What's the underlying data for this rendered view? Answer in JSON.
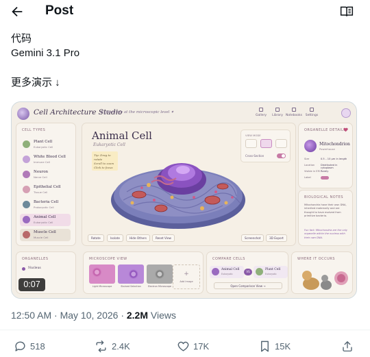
{
  "header": {
    "title": "Post"
  },
  "post": {
    "line1": "代码",
    "line2": "Gemini 3.1 Pro",
    "line3": "更多演示 ↓"
  },
  "video": {
    "timer": "0:07",
    "app": {
      "name": "Cell Architecture Studio",
      "tagline": "Explore life at the microscopic level ✦",
      "nav": [
        "Gallery",
        "Library",
        "Notebooks",
        "Settings"
      ],
      "cell_types": {
        "title": "Cell Types",
        "items": [
          {
            "name": "Plant Cell",
            "sub": "Eukaryotic Cell"
          },
          {
            "name": "White Blood Cell",
            "sub": "Immune Cell"
          },
          {
            "name": "Neuron",
            "sub": "Nerve Cell"
          },
          {
            "name": "Epithelial Cell",
            "sub": "Tissue Cell"
          },
          {
            "name": "Bacteria Cell",
            "sub": "Prokaryotic Cell"
          },
          {
            "name": "Animal Cell",
            "sub": "Eukaryotic Cell"
          },
          {
            "name": "Muscle Cell",
            "sub": "Muscle Cell"
          }
        ]
      },
      "main": {
        "title": "Animal Cell",
        "subtitle": "Eukaryotic Cell",
        "sticky": [
          "Tip: Drag to rotate",
          "Scroll to zoom",
          "Click to focus"
        ],
        "view_mode_title": "VIEW MODE",
        "cross_section_label": "Cross-Section",
        "tools": [
          "Rotate",
          "Isolate",
          "Hide Others",
          "Reset View"
        ],
        "tools_right": [
          "Screenshot",
          "3D Export"
        ]
      },
      "details": {
        "title": "Organelle Details",
        "name": "Mitochondrion",
        "sub": "Powerhouse",
        "rows": [
          {
            "k": "Size",
            "v": "0.5 – 10 µm in length"
          },
          {
            "k": "Location",
            "v": "Distributed in cytoplasm"
          },
          {
            "k": "Visible in EM",
            "v": "Rarely"
          },
          {
            "k": "Label",
            "v": ""
          }
        ]
      },
      "notes": {
        "title": "Biological Notes",
        "text": "Mitochondria have their own DNA, inherited maternally and are thought to have evolved from primitive bacteria.",
        "extra": "Fun fact: Mitochondria are the only organelle within the nucleus with their own DNA."
      },
      "organelles": {
        "title": "Organelles",
        "item": "Nucleus"
      },
      "microscope": {
        "title": "Microscope View",
        "thumbs": [
          "Light Microscope",
          "Stained Selection",
          "Electron Microscope"
        ],
        "add": "Add Image"
      },
      "compare": {
        "title": "Compare Cells",
        "a": {
          "name": "Animal Cell",
          "sub": "Eukaryotic"
        },
        "vs": "VS",
        "b": {
          "name": "Plant Cell",
          "sub": "Eukaryotic"
        },
        "button": "Open Comparison View →"
      },
      "where": {
        "title": "Where It Occurs"
      }
    }
  },
  "meta": {
    "time": "12:50 AM · May 10, 2026 · ",
    "views_count": "2.2M",
    "views_label": " Views"
  },
  "actions": {
    "replies": "518",
    "reposts": "2.4K",
    "likes": "17K",
    "bookmarks": "15K"
  },
  "colors": {
    "accent": "#8a5aa8",
    "text": "#0f1419",
    "muted": "#536471"
  }
}
